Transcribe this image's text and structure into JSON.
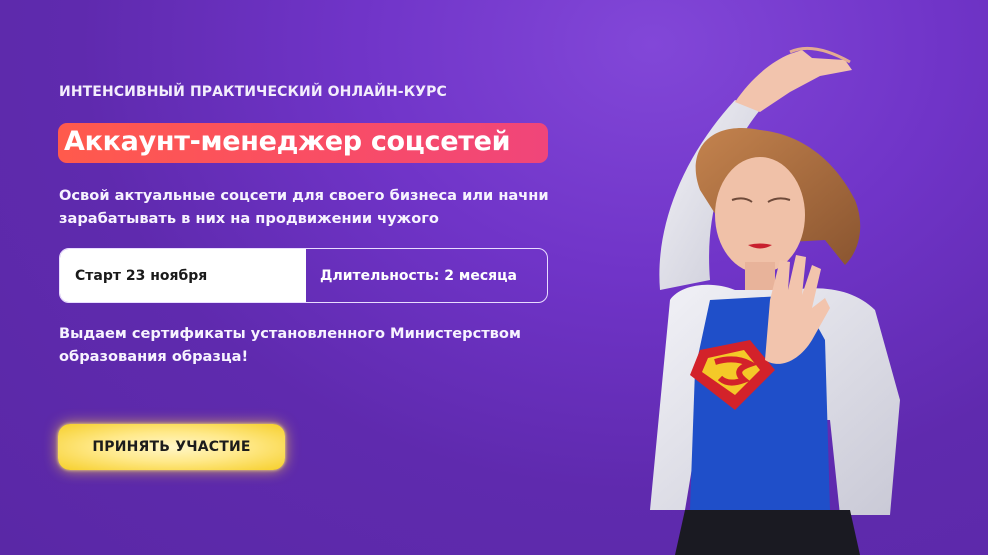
{
  "hero": {
    "eyebrow": "ИНТЕНСИВНЫЙ ПРАКТИЧЕСКИЙ ОНЛАЙН-КУРС",
    "title": "Аккаунт-менеджер соцсетей",
    "description": "Освой актуальные соцсети для своего бизнеса или начни зарабатывать в них на продвижении чужого",
    "start": "Старт 23 ноября",
    "duration": "Длительность: 2 месяца",
    "certificate": "Выдаем сертификаты установленного Министерством образования образца!",
    "cta_label": "ПРИНЯТЬ УЧАСТИЕ"
  },
  "colors": {
    "background": "#6a30be",
    "title_badge_start": "#ff5a4c",
    "title_badge_end": "#f0457a",
    "cta": "#ffe98a"
  }
}
